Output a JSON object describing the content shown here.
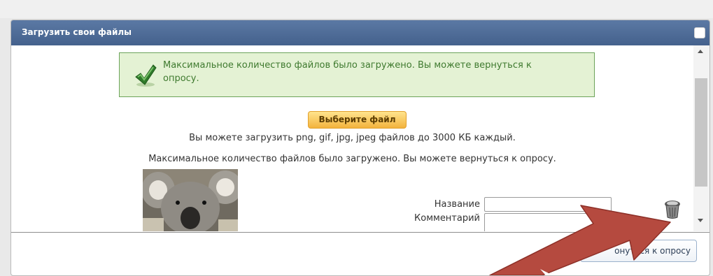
{
  "topstrip": {
    "ghost_text": ""
  },
  "dialog": {
    "title": "Загрузить свои файлы",
    "close_icon": "checkbox-icon"
  },
  "success_message": "Максимальное количество файлов было загружено. Вы можете вернуться к опросу.",
  "upload": {
    "choose_label": "Выберите файл",
    "info_text": "Вы можете загрузить png, gif, jpg, jpeg файлов до 3000 КБ каждый.",
    "max_text": "Максимальное количество файлов было загружено. Вы можете вернуться к опросу."
  },
  "file_entry": {
    "name_label": "Название",
    "comment_label": "Комментарий",
    "name_value": "",
    "comment_value": "",
    "thumbnail_icon": "koala-photo",
    "delete_icon": "trash-icon"
  },
  "footer": {
    "return_label": "онуться к опросу"
  },
  "colors": {
    "titlebar": "#4d6b97",
    "success_bg": "#e4f2d4",
    "success_border": "#6ca35a",
    "success_text": "#3f7a2f",
    "choose_btn": "#f7c24a",
    "arrow": "#b54a3f"
  }
}
